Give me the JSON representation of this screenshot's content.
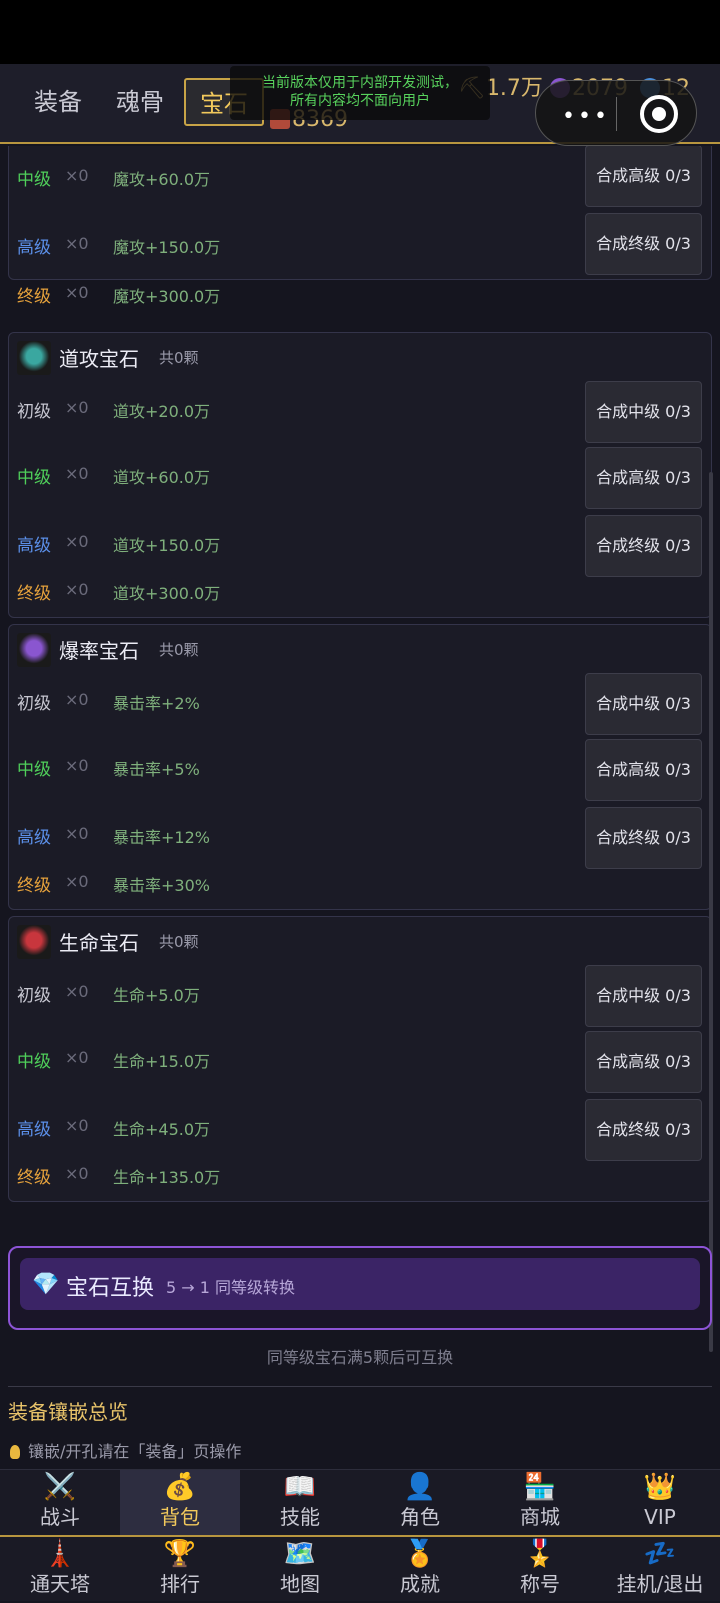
{
  "tabs": [
    "装备",
    "魂骨",
    "宝石"
  ],
  "currencies": {
    "c1": "1.7万",
    "c2": "2079",
    "c3": "12",
    "c4": "8369"
  },
  "notice": {
    "line1": "当前版本仅用于内部开发测试，",
    "line2": "所有内容均不面向用户"
  },
  "capsule": {
    "dots": "•••"
  },
  "partial_card": {
    "rows": [
      {
        "level": "中级",
        "qty": "×0",
        "stat": "魔攻+60.0万",
        "button": "合成高级 0/3"
      },
      {
        "level": "高级",
        "qty": "×0",
        "stat": "魔攻+150.0万",
        "button": "合成终级 0/3"
      },
      {
        "level": "终级",
        "qty": "×0",
        "stat": "魔攻+300.0万"
      }
    ]
  },
  "gems": [
    {
      "name": "道攻宝石",
      "count": "共0颗",
      "color": "#3aa7a0",
      "rows": [
        {
          "level": "初级",
          "qty": "×0",
          "stat": "道攻+20.0万",
          "button": "合成中级 0/3"
        },
        {
          "level": "中级",
          "qty": "×0",
          "stat": "道攻+60.0万",
          "button": "合成高级 0/3"
        },
        {
          "level": "高级",
          "qty": "×0",
          "stat": "道攻+150.0万",
          "button": "合成终级 0/3"
        },
        {
          "level": "终级",
          "qty": "×0",
          "stat": "道攻+300.0万"
        }
      ]
    },
    {
      "name": "爆率宝石",
      "count": "共0颗",
      "color": "#8a56d0",
      "rows": [
        {
          "level": "初级",
          "qty": "×0",
          "stat": "暴击率+2%",
          "button": "合成中级 0/3"
        },
        {
          "level": "中级",
          "qty": "×0",
          "stat": "暴击率+5%",
          "button": "合成高级 0/3"
        },
        {
          "level": "高级",
          "qty": "×0",
          "stat": "暴击率+12%",
          "button": "合成终级 0/3"
        },
        {
          "level": "终级",
          "qty": "×0",
          "stat": "暴击率+30%"
        }
      ]
    },
    {
      "name": "生命宝石",
      "count": "共0颗",
      "color": "#c8363d",
      "rows": [
        {
          "level": "初级",
          "qty": "×0",
          "stat": "生命+5.0万",
          "button": "合成中级 0/3"
        },
        {
          "level": "中级",
          "qty": "×0",
          "stat": "生命+15.0万",
          "button": "合成高级 0/3"
        },
        {
          "level": "高级",
          "qty": "×0",
          "stat": "生命+45.0万",
          "button": "合成终级 0/3"
        },
        {
          "level": "终级",
          "qty": "×0",
          "stat": "生命+135.0万"
        }
      ]
    }
  ],
  "exchange": {
    "title": "宝石互换",
    "subtitle": "5 → 1 同等级转换",
    "hint": "同等级宝石满5颗后可互换"
  },
  "overview": {
    "title": "装备镶嵌总览",
    "tip": "镶嵌/开孔请在「装备」页操作"
  },
  "nav1": [
    {
      "label": "战斗",
      "icon": "crossed-swords-icon",
      "glyph": "⚔️"
    },
    {
      "label": "背包",
      "icon": "money-bag-icon",
      "glyph": "💰"
    },
    {
      "label": "技能",
      "icon": "book-icon",
      "glyph": "📖"
    },
    {
      "label": "角色",
      "icon": "person-icon",
      "glyph": "👤"
    },
    {
      "label": "商城",
      "icon": "store-icon",
      "glyph": "🏪"
    },
    {
      "label": "VIP",
      "icon": "crown-icon",
      "glyph": "👑"
    }
  ],
  "nav2": [
    {
      "label": "通天塔",
      "icon": "tower-icon",
      "glyph": "🗼"
    },
    {
      "label": "排行",
      "icon": "trophy-icon",
      "glyph": "🏆"
    },
    {
      "label": "地图",
      "icon": "map-icon",
      "glyph": "🗺️"
    },
    {
      "label": "成就",
      "icon": "medal-icon",
      "glyph": "🏅"
    },
    {
      "label": "称号",
      "icon": "ribbon-icon",
      "glyph": "🎖️"
    },
    {
      "label": "挂机/退出",
      "icon": "sleep-icon",
      "glyph": "💤"
    }
  ],
  "colors": {
    "accent_gold": "#c8a447",
    "exchange_purple": "#8d54d6"
  }
}
